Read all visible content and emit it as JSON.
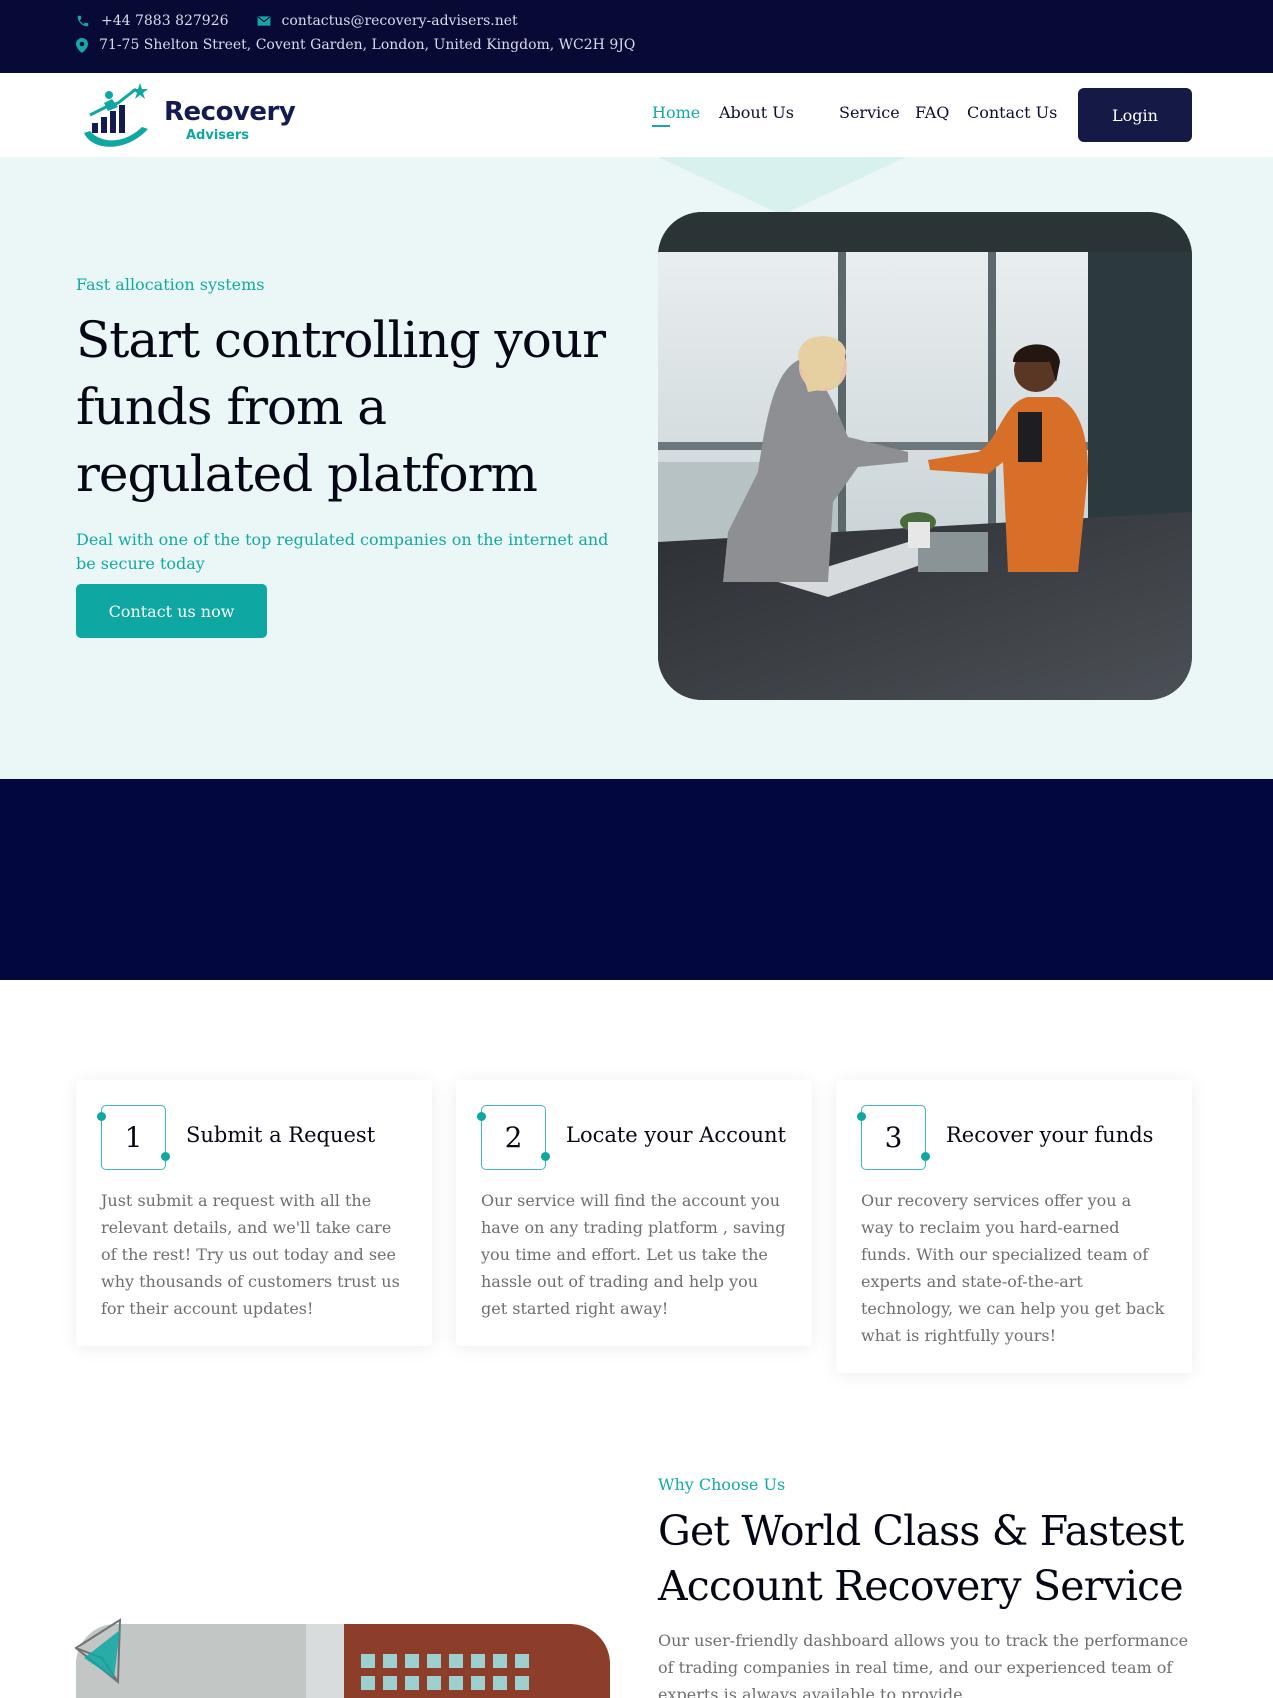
{
  "topbar": {
    "phone": "+44 7883 827926",
    "email": "contactus@recovery-advisers.net",
    "address": "71-75 Shelton Street, Covent Garden, London, United Kingdom, WC2H 9JQ"
  },
  "brand": {
    "name": "Recovery",
    "tagline": "Advisers"
  },
  "nav": {
    "items": [
      {
        "label": "Home",
        "active": true
      },
      {
        "label": "About Us"
      },
      {
        "label": "Service"
      },
      {
        "label": "FAQ"
      },
      {
        "label": "Contact Us"
      }
    ],
    "login": "Login"
  },
  "hero": {
    "eyebrow": "Fast allocation systems",
    "title": "Start controlling your funds from a regulated platform",
    "subtitle": "Deal with one of the top regulated companies on the internet and be secure today",
    "cta": "Contact us now"
  },
  "steps": [
    {
      "number": "1",
      "title": "Submit a Request",
      "text": "Just submit a request with all the relevant details, and we'll take care of the rest! Try us out today and see why thousands of customers trust us for their account updates!"
    },
    {
      "number": "2",
      "title": "Locate your Account",
      "text": "Our service will find the account you have on any trading platform , saving you time and effort. Let us take the hassle out of trading and help you get started right away!"
    },
    {
      "number": "3",
      "title": "Recover your funds",
      "text": "Our recovery services offer you a way to reclaim you hard-earned funds. With our specialized team of experts and state-of-the-art technology, we can help you get back what is rightfully yours!"
    }
  ],
  "why": {
    "eyebrow": "Why Choose Us",
    "title": "Get World Class & Fastest Account Recovery Service",
    "text": "Our user-friendly dashboard allows you to track the performance of trading companies in real time, and our experienced team of experts is always available to provide"
  },
  "colors": {
    "navy": "#080a36",
    "teal": "#0ea7a1",
    "hero_bg": "#eaf7f6",
    "band": "#030740"
  },
  "icons": [
    "phone-icon",
    "mail-icon",
    "location-pin-icon",
    "paper-plane-icon"
  ]
}
